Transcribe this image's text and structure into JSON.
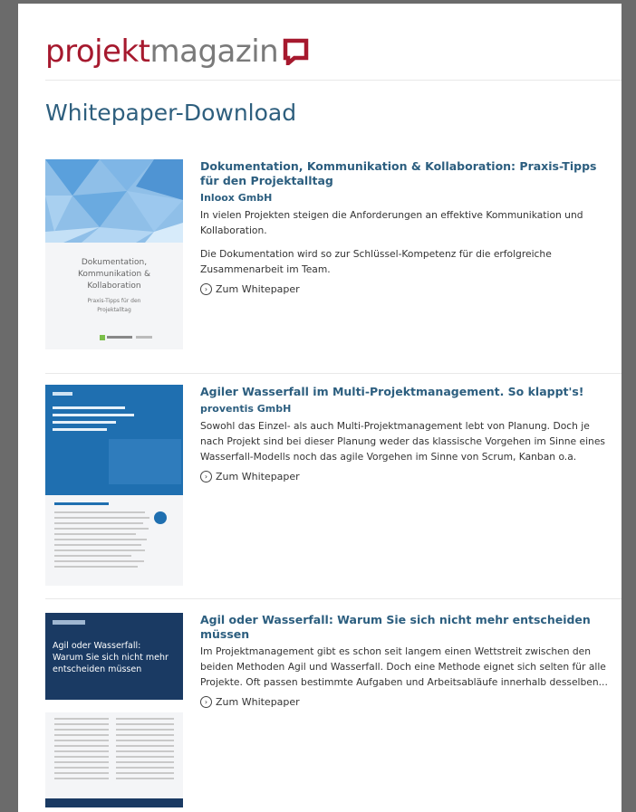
{
  "logo": {
    "part1": "projekt",
    "part2": "magazin"
  },
  "page_title": "Whitepaper-Download",
  "entries": [
    {
      "title": "Dokumentation, Kommunikation & Kollaboration: Praxis-Tipps für den Projektalltag",
      "company": "Inloox GmbH",
      "desc1": "In vielen Projekten steigen die Anforderungen an effektive Kommunikation und Kollaboration.",
      "desc2": "Die Dokumentation wird so zur Schlüssel-Kompetenz für die erfolgreiche Zusammenarbeit im Team.",
      "cta": "Zum Whitepaper",
      "cover": {
        "line1": "Dokumentation,",
        "line2": "Kommunikation &",
        "line3": "Kollaboration",
        "line4": "Praxis-Tipps für den",
        "line5": "Projektalltag"
      }
    },
    {
      "title": "Agiler Wasserfall im Multi-Projektmanagement. So klappt's!",
      "company": "proventis GmbH",
      "desc1": "Sowohl das Einzel- als auch Multi-Projektmanagement lebt von Planung. Doch je nach Projekt sind bei dieser Planung weder das klassische Vorgehen im Sinne eines Wasserfall-Modells noch das agile Vorgehen im Sinne von Scrum, Kanban o.a.",
      "cta": "Zum Whitepaper"
    },
    {
      "title": "Agil oder Wasserfall: Warum Sie sich nicht mehr entscheiden müssen",
      "desc1": "Im Projektmanagement gibt es schon seit langem einen Wettstreit zwischen den beiden Methoden Agil und Wasserfall. Doch eine Methode eignet sich selten für alle Projekte. Oft passen bestimmte Aufgaben und Arbeitsabläufe innerhalb desselben...",
      "cta": "Zum Whitepaper",
      "cover": {
        "line1": "Agil oder Wasserfall:",
        "line2": "Warum Sie sich nicht mehr",
        "line3": "entscheiden müssen"
      }
    }
  ],
  "colors": {
    "brand": "#a6192e",
    "heading": "#2e5f7e",
    "link": "#2c5e7f"
  },
  "icons": {
    "cta": "circle-arrow-right-icon",
    "logo": "speech-bubble-icon"
  }
}
